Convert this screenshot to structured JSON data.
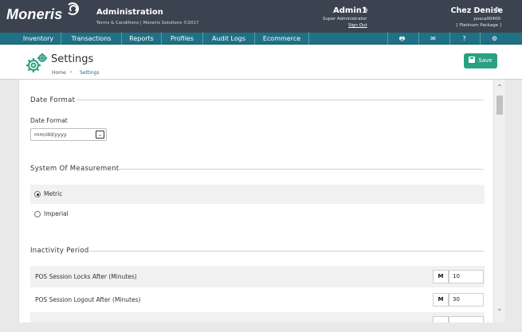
{
  "header": {
    "logo": "Moneris",
    "app_title": "Administration",
    "app_subtitle": "Terms & Conditions | Moneris Solutions ©2017",
    "user": {
      "name": "Admin1",
      "role": "Super Administrator",
      "sign_out": "Sign Out"
    },
    "store": {
      "name": "Chez Denise",
      "id": "posca00400",
      "package": "[ Platinum Package ]"
    }
  },
  "nav": {
    "items": [
      "Inventory",
      "Transactions",
      "Reports",
      "Profiles",
      "Audit Logs",
      "Ecommerce"
    ],
    "icons": [
      "printer-icon",
      "mail-icon",
      "help-icon",
      "settings-icon"
    ]
  },
  "page": {
    "title": "Settings",
    "breadcrumb": {
      "home": "Home",
      "separator": "›",
      "current": "Settings"
    },
    "save_label": "Save"
  },
  "date_format": {
    "section_title": "Date Format",
    "field_label": "Date Format",
    "selected": "mm/dd/yyyy"
  },
  "measurement": {
    "section_title": "System Of Measurement",
    "options": [
      {
        "label": "Metric",
        "selected": true
      },
      {
        "label": "Imperial",
        "selected": false
      }
    ]
  },
  "inactivity": {
    "section_title": "Inactivity Period",
    "rows": [
      {
        "label": "POS Session Locks After (Minutes)",
        "unit": "M",
        "value": "10"
      },
      {
        "label": "POS Session Logout After (Minutes)",
        "unit": "M",
        "value": "30"
      }
    ]
  },
  "colors": {
    "header_bg": "#3b4350",
    "nav_bg": "#1f7185",
    "accent": "#2ba083"
  }
}
